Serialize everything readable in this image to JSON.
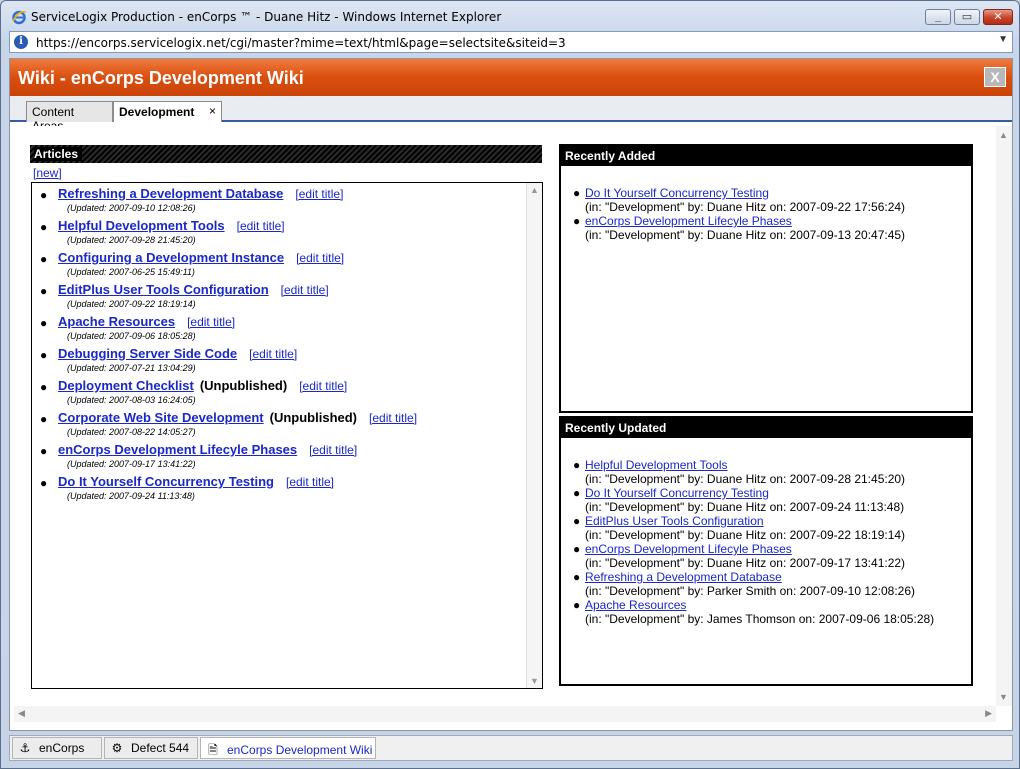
{
  "window": {
    "title": "ServiceLogix Production - enCorps ™ - Duane Hitz - Windows Internet Explorer",
    "url": "https://encorps.servicelogix.net/cgi/master?mime=text/html&page=selectsite&siteid=3"
  },
  "wiki": {
    "title": "Wiki - enCorps Development Wiki",
    "close_label": "X"
  },
  "tabs": [
    {
      "label": "Content Areas"
    },
    {
      "label": "Development",
      "close": "×"
    }
  ],
  "articles": {
    "header": "Articles",
    "new_label": "[new]",
    "edit_label": "[edit title]",
    "items": [
      {
        "title": "Refreshing a Development Database",
        "status": "",
        "updated": "(Updated: 2007-09-10 12:08:26)"
      },
      {
        "title": "Helpful Development Tools",
        "status": "",
        "updated": "(Updated: 2007-09-28 21:45:20)"
      },
      {
        "title": "Configuring a Development Instance",
        "status": "",
        "updated": "(Updated: 2007-06-25 15:49:11)"
      },
      {
        "title": "EditPlus User Tools Configuration",
        "status": "",
        "updated": "(Updated: 2007-09-22 18:19:14)"
      },
      {
        "title": "Apache Resources",
        "status": "",
        "updated": "(Updated: 2007-09-06 18:05:28)"
      },
      {
        "title": "Debugging Server Side Code",
        "status": "",
        "updated": "(Updated: 2007-07-21 13:04:29)"
      },
      {
        "title": "Deployment Checklist",
        "status": "(Unpublished)",
        "updated": "(Updated: 2007-08-03 16:24:05)"
      },
      {
        "title": "Corporate Web Site Development",
        "status": "(Unpublished)",
        "updated": "(Updated: 2007-08-22 14:05:27)"
      },
      {
        "title": "enCorps Development Lifecyle Phases",
        "status": "",
        "updated": "(Updated: 2007-09-17 13:41:22)"
      },
      {
        "title": "Do It Yourself Concurrency Testing",
        "status": "",
        "updated": "(Updated: 2007-09-24 11:13:48)"
      }
    ]
  },
  "recently_added": {
    "header": "Recently Added",
    "items": [
      {
        "title": "Do It Yourself Concurrency Testing",
        "meta": "(in: \"Development\" by: Duane Hitz on: 2007-09-22 17:56:24)"
      },
      {
        "title": "enCorps Development Lifecyle Phases",
        "meta": "(in: \"Development\" by: Duane Hitz on: 2007-09-13 20:47:45)"
      }
    ]
  },
  "recently_updated": {
    "header": "Recently Updated",
    "items": [
      {
        "title": "Helpful Development Tools",
        "meta": "(in: \"Development\" by: Duane Hitz on: 2007-09-28 21:45:20)"
      },
      {
        "title": "Do It Yourself Concurrency Testing",
        "meta": "(in: \"Development\" by: Duane Hitz on: 2007-09-24 11:13:48)"
      },
      {
        "title": "EditPlus User Tools Configuration",
        "meta": "(in: \"Development\" by: Duane Hitz on: 2007-09-22 18:19:14)"
      },
      {
        "title": "enCorps Development Lifecyle Phases",
        "meta": "(in: \"Development\" by: Duane Hitz on: 2007-09-17 13:41:22)"
      },
      {
        "title": "Refreshing a Development Database",
        "meta": "(in: \"Development\" by: Parker Smith on: 2007-09-10 12:08:26)"
      },
      {
        "title": "Apache Resources",
        "meta": "(in: \"Development\" by: James Thomson on: 2007-09-06 18:05:28)"
      }
    ]
  },
  "taskbar": [
    {
      "label": "enCorps",
      "icon": "anchor-icon"
    },
    {
      "label": "Defect 544",
      "icon": "gear-icon"
    },
    {
      "label": "enCorps Development Wiki",
      "icon": "wiki-page-icon"
    }
  ],
  "colors": {
    "header_orange": "#d94f10",
    "link_blue": "#1a27c9",
    "tab_underline": "#3a5aa0"
  }
}
